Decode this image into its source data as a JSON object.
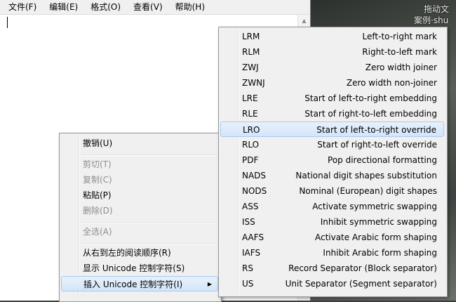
{
  "menubar": {
    "items": [
      "文件(F)",
      "编辑(E)",
      "格式(O)",
      "查看(V)",
      "帮助(H)"
    ]
  },
  "desktop": {
    "labels": [
      "拖动文",
      "案例·shu",
      "拖动文"
    ]
  },
  "context_menu": {
    "items": [
      {
        "label": "撤销(U)",
        "disabled": false
      },
      {
        "label": "剪切(T)",
        "disabled": true
      },
      {
        "label": "复制(C)",
        "disabled": true
      },
      {
        "label": "粘贴(P)",
        "disabled": false
      },
      {
        "label": "删除(D)",
        "disabled": true
      },
      {
        "label": "全选(A)",
        "disabled": true
      },
      {
        "label": "从右到左的阅读顺序(R)",
        "disabled": false
      },
      {
        "label": "显示 Unicode 控制字符(S)",
        "disabled": false
      },
      {
        "label": "插入 Unicode 控制字符(I)",
        "disabled": false,
        "highlighted": true,
        "submenu": true
      }
    ]
  },
  "unicode_submenu": {
    "items": [
      {
        "code": "LRM",
        "desc": "Left-to-right mark"
      },
      {
        "code": "RLM",
        "desc": "Right-to-left mark"
      },
      {
        "code": "ZWJ",
        "desc": "Zero width joiner"
      },
      {
        "code": "ZWNJ",
        "desc": "Zero width non-joiner"
      },
      {
        "code": "LRE",
        "desc": "Start of left-to-right embedding"
      },
      {
        "code": "RLE",
        "desc": "Start of right-to-left embedding"
      },
      {
        "code": "LRO",
        "desc": "Start of left-to-right override",
        "highlighted": true
      },
      {
        "code": "RLO",
        "desc": "Start of right-to-left override"
      },
      {
        "code": "PDF",
        "desc": "Pop directional formatting"
      },
      {
        "code": "NADS",
        "desc": "National digit shapes substitution"
      },
      {
        "code": "NODS",
        "desc": "Nominal (European) digit shapes"
      },
      {
        "code": "ASS",
        "desc": "Activate symmetric swapping"
      },
      {
        "code": "ISS",
        "desc": "Inhibit symmetric swapping"
      },
      {
        "code": "AAFS",
        "desc": "Activate Arabic form shaping"
      },
      {
        "code": "IAFS",
        "desc": "Inhibit Arabic form shaping"
      },
      {
        "code": "RS",
        "desc": "Record Separator (Block separator)"
      },
      {
        "code": "US",
        "desc": "Unit Separator (Segment separator)"
      }
    ]
  }
}
